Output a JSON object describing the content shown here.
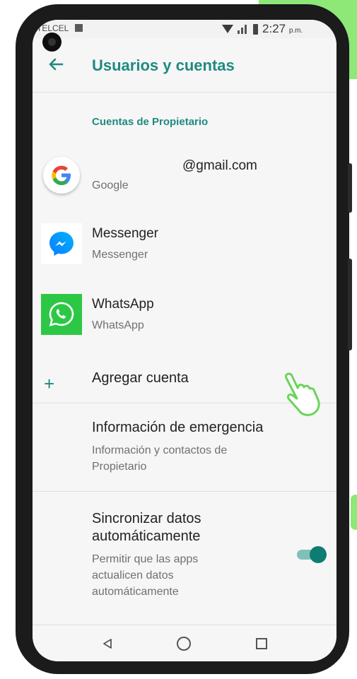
{
  "status_bar": {
    "carrier": "TELCEL",
    "time": "2:27",
    "time_suffix": "p.m."
  },
  "app_bar": {
    "back_icon": "arrow-left-icon",
    "title": "Usuarios y cuentas"
  },
  "section": {
    "title": "Cuentas de Propietario"
  },
  "accounts": [
    {
      "title": "@gmail.com",
      "subtitle": "Google",
      "icon": "google-icon"
    },
    {
      "title": "Messenger",
      "subtitle": "Messenger",
      "icon": "messenger-icon"
    },
    {
      "title": "WhatsApp",
      "subtitle": "WhatsApp",
      "icon": "whatsapp-icon"
    }
  ],
  "add_account": {
    "icon": "plus-icon",
    "label": "Agregar cuenta"
  },
  "emergency": {
    "title": "Información de emergencia",
    "subtitle": "Información y contactos de Propietario"
  },
  "sync": {
    "title": "Sincronizar datos automáticamente",
    "subtitle": "Permitir que las apps actualicen datos automáticamente",
    "enabled": true
  },
  "nav_bar": {
    "back_icon": "triangle-back-icon",
    "home_icon": "circle-home-icon",
    "recent_icon": "square-recents-icon"
  },
  "colors": {
    "accent": "#1f8a80",
    "highlight": "#8ee878"
  }
}
